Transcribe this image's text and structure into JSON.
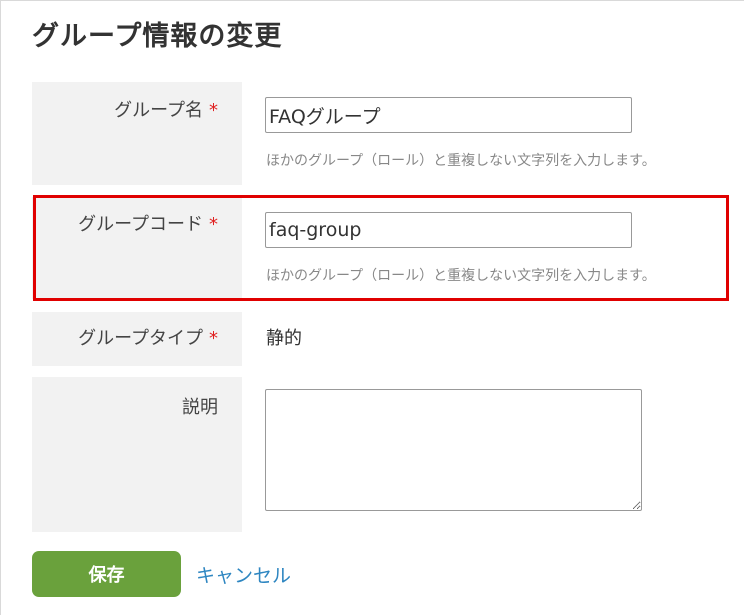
{
  "page": {
    "title": "グループ情報の変更"
  },
  "form": {
    "required_mark": "*",
    "group_name": {
      "label": "グループ名",
      "value": "FAQグループ",
      "hint": "ほかのグループ（ロール）と重複しない文字列を入力します。"
    },
    "group_code": {
      "label": "グループコード",
      "value": "faq-group",
      "hint": "ほかのグループ（ロール）と重複しない文字列を入力します。"
    },
    "group_type": {
      "label": "グループタイプ",
      "value": "静的"
    },
    "description": {
      "label": "説明",
      "value": ""
    }
  },
  "actions": {
    "save_label": "保存",
    "cancel_label": "キャンセル"
  },
  "colors": {
    "highlight": "#e00000",
    "save_button": "#6aa13c",
    "cancel_link": "#2e86c1",
    "required": "#e02020"
  }
}
